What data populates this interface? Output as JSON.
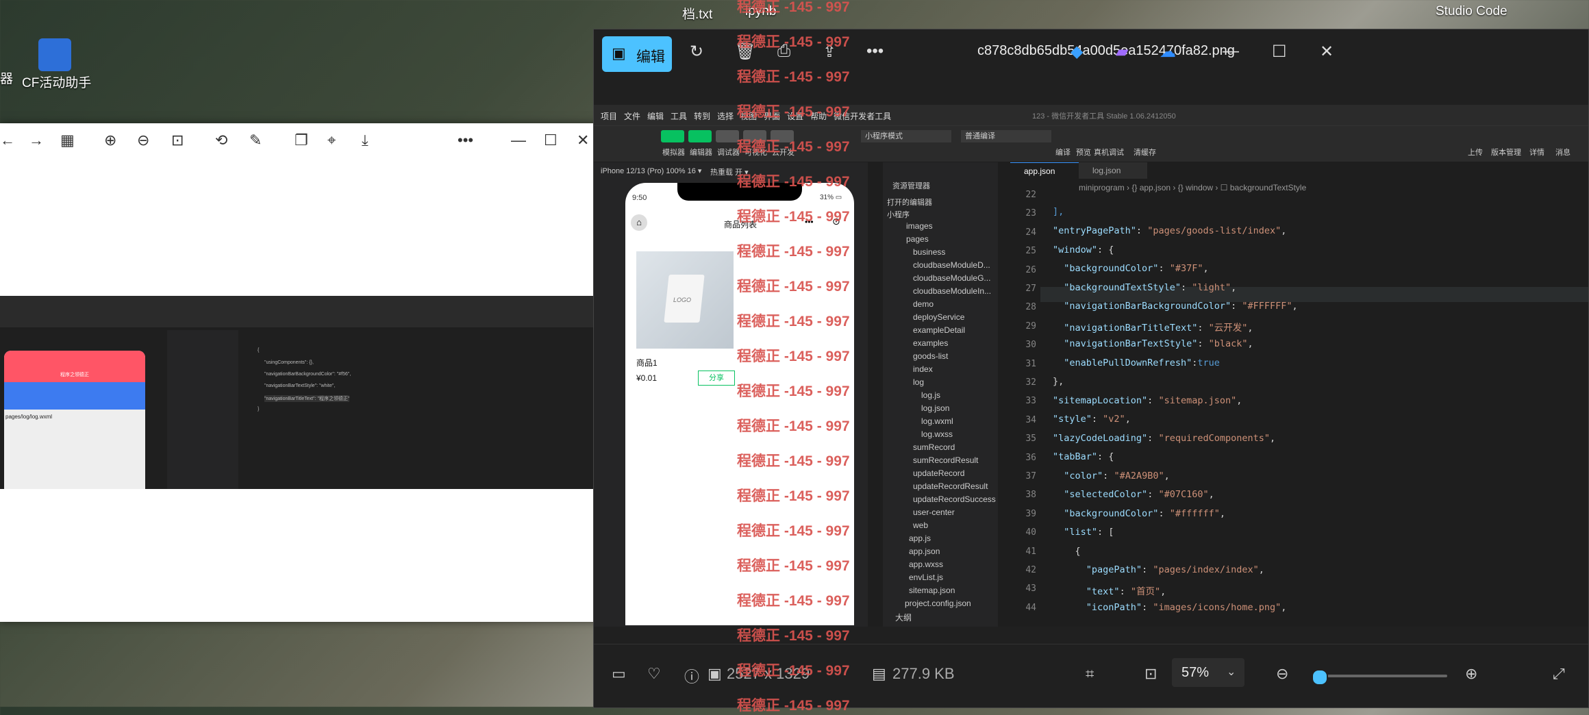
{
  "desktop": {
    "top_labels": [
      "档.txt",
      "ipynb"
    ],
    "studio_label": "Studio Code",
    "cf_label": "CF活动助手",
    "left_partial": "器"
  },
  "watermark": "程德正 -145 - 997",
  "viewer": {
    "edit_label": "编辑",
    "filename": "c878c8db65db54a00d5ea152470fa82.png",
    "dimensions": "2527 x 1329",
    "filesize": "277.9 KB",
    "zoom": "57%",
    "zoom_fraction": 0.04
  },
  "devtools": {
    "menu": [
      "项目",
      "文件",
      "编辑",
      "工具",
      "转到",
      "选择",
      "视图",
      "界面",
      "设置",
      "帮助",
      "微信开发者工具"
    ],
    "title": "123 - 微信开发者工具 Stable 1.06.2412050",
    "tool_labels": [
      "模拟器",
      "编辑器",
      "调试器",
      "可视化",
      "云开发"
    ],
    "mode_select": "小程序模式",
    "compile_select": "普通编译",
    "right_labels": [
      "编译",
      "预览",
      "真机调试",
      "清缓存",
      "上传",
      "版本管理",
      "详情",
      "消息"
    ],
    "device": "iPhone 12/13 (Pro) 100% 16 ▾",
    "hotreload": "热重载 开 ▾",
    "phone": {
      "time": "9:50",
      "battery": "31% ▭",
      "title": "商品列表",
      "product_name": "商品1",
      "price": "¥0.01",
      "share_label": "分享",
      "bag_text": "LOGO"
    },
    "explorer_title": "资源管理器",
    "open_editors": "打开的编辑器",
    "project": "小程序",
    "tree": [
      "images",
      "pages",
      "business",
      "cloudbaseModuleD...",
      "cloudbaseModuleG...",
      "cloudbaseModuleIn...",
      "demo",
      "deployService",
      "exampleDetail",
      "examples",
      "goods-list",
      "index",
      "log",
      "log.js",
      "log.json",
      "log.wxml",
      "log.wxss",
      "sumRecord",
      "sumRecordResult",
      "updateRecord",
      "updateRecordResult",
      "updateRecordSuccess",
      "user-center",
      "web",
      "app.js",
      "app.json",
      "app.wxss",
      "envList.js",
      "sitemap.json",
      "project.config.json",
      "大纲"
    ],
    "tabs": [
      "app.json",
      "log.json"
    ],
    "breadcrumb": "miniprogram › {} app.json › {} window › ☐ backgroundTextStyle",
    "lines": [
      "22",
      "23",
      "24",
      "25",
      "26",
      "27",
      "28",
      "29",
      "30",
      "31",
      "32",
      "33",
      "34",
      "35",
      "36",
      "37",
      "38",
      "39",
      "40",
      "41",
      "42",
      "43",
      "44"
    ]
  },
  "left_window": {
    "code": [
      "{",
      "\"usingComponents\": {},",
      "\"navigationBarBackgroundColor\": \"#f56\",",
      "\"navigationBarTextStyle\": \"white\",",
      "\"navigationBarTitleText\": \"程序之领德正\"",
      "}"
    ],
    "phone_title": "程序之领德正",
    "path": "pages/log/log.wxml"
  }
}
